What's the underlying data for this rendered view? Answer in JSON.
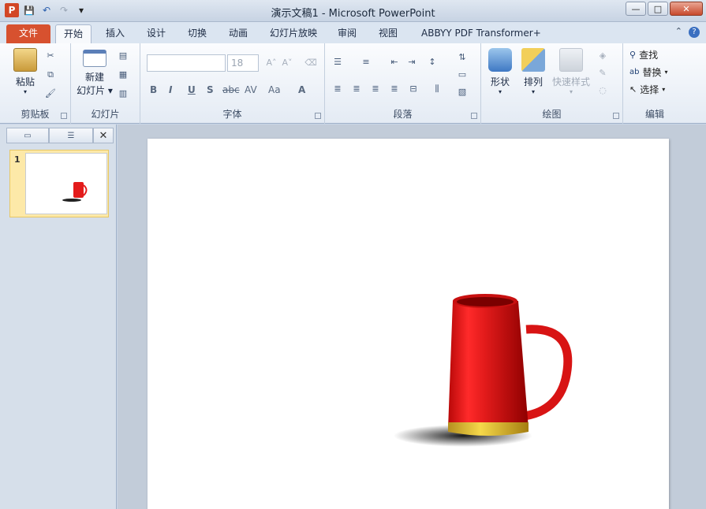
{
  "window": {
    "title": "演示文稿1 - Microsoft PowerPoint",
    "buttons": {
      "minimize": "—",
      "maximize": "□",
      "close": "✕"
    }
  },
  "qat": {
    "logo": "P",
    "save": "💾",
    "undo": "↶",
    "redo": "↷",
    "more": "▾"
  },
  "tabs": [
    {
      "label": "文件"
    },
    {
      "label": "开始"
    },
    {
      "label": "插入"
    },
    {
      "label": "设计"
    },
    {
      "label": "切换"
    },
    {
      "label": "动画"
    },
    {
      "label": "幻灯片放映"
    },
    {
      "label": "审阅"
    },
    {
      "label": "视图"
    },
    {
      "label": "ABBYY PDF Transformer+"
    }
  ],
  "ribbon": {
    "clipboard": {
      "label": "剪贴板",
      "paste": "粘贴"
    },
    "slides": {
      "label": "幻灯片",
      "new_slide_line1": "新建",
      "new_slide_line2": "幻灯片 ▾"
    },
    "font": {
      "label": "字体",
      "font_name": "",
      "font_size": "18",
      "bold": "B",
      "italic": "I",
      "underline": "U",
      "shadow": "S",
      "strike": "abc",
      "spacing": "AV",
      "case": "Aa",
      "color": "A"
    },
    "paragraph": {
      "label": "段落"
    },
    "drawing": {
      "label": "绘图",
      "shapes": "形状",
      "arrange": "排列",
      "quick_styles": "快速样式"
    },
    "editing": {
      "label": "编辑",
      "find": "查找",
      "replace": "替换",
      "select": "选择"
    }
  },
  "slides_pane": {
    "thumb_number": "1"
  },
  "colors": {
    "file_tab": "#d7512f",
    "mug_red": "#e31b1b",
    "mug_gold": "#e8c33a"
  }
}
